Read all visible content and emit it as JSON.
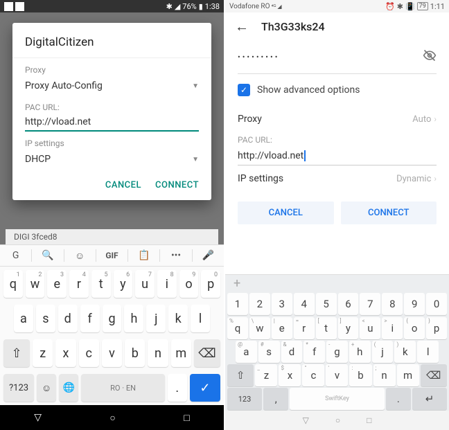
{
  "left": {
    "status": {
      "battery": "76%",
      "time": "1:38"
    },
    "dialog": {
      "title": "DigitalCitizen",
      "proxy_label": "Proxy",
      "proxy_value": "Proxy Auto-Config",
      "pac_label": "PAC URL:",
      "pac_value": "http://vload.net",
      "ip_label": "IP settings",
      "ip_value": "DHCP",
      "cancel": "CANCEL",
      "connect": "CONNECT"
    },
    "bg_wifi": "DIGI 3fced8",
    "kb": {
      "top": [
        "G",
        "🔍",
        "☺",
        "GIF",
        "📋",
        "•••",
        "🎤"
      ],
      "row1": [
        "q",
        "w",
        "e",
        "r",
        "t",
        "y",
        "u",
        "i",
        "o",
        "p"
      ],
      "row1_alt": [
        "1",
        "2",
        "3",
        "4",
        "5",
        "6",
        "7",
        "8",
        "9",
        "0"
      ],
      "row2": [
        "a",
        "s",
        "d",
        "f",
        "g",
        "h",
        "j",
        "k",
        "l"
      ],
      "row3": [
        "z",
        "x",
        "c",
        "v",
        "b",
        "n",
        "m"
      ],
      "shift": "⇧",
      "back": "⌫",
      "sym": "?123",
      "emoji": "☺",
      "globe": "🌐",
      "space": "RO · EN",
      "dot": ".",
      "enter": "✓"
    }
  },
  "right": {
    "status": {
      "carrier": "Vodafone RO",
      "battery": "79",
      "time": "1:11"
    },
    "title": "Th3G33ks24",
    "password_mask": "•••••••••",
    "show_adv": "Show advanced options",
    "proxy_label": "Proxy",
    "proxy_value": "Auto",
    "pac_label": "PAC URL:",
    "pac_value": "http://vload.net",
    "ip_label": "IP settings",
    "ip_value": "Dynamic",
    "cancel": "CANCEL",
    "connect": "CONNECT",
    "kb": {
      "nums": [
        "1",
        "2",
        "3",
        "4",
        "5",
        "6",
        "7",
        "8",
        "9",
        "0"
      ],
      "row1": [
        "q",
        "w",
        "e",
        "r",
        "t",
        "y",
        "u",
        "i",
        "o",
        "p"
      ],
      "row1_alt": [
        "%",
        "\\",
        "|",
        "=",
        "[",
        "]",
        "<",
        ">",
        "{",
        "}"
      ],
      "row2": [
        "a",
        "s",
        "d",
        "f",
        "g",
        "h",
        "j",
        "k",
        "l"
      ],
      "row2_alt": [
        "@",
        "#",
        "&",
        "*",
        "-",
        "+",
        "(",
        ")",
        ""
      ],
      "row3": [
        "z",
        "x",
        "c",
        "v",
        "b",
        "n",
        "m"
      ],
      "row3_alt": [
        "_",
        "$",
        "\"",
        "'",
        ":",
        ";",
        ""
      ],
      "shift": "⇧",
      "back": "⌫",
      "sym": "123",
      "comma": ",",
      "space": "SwiftKey",
      "dot": ".",
      "enter": "↵"
    }
  }
}
